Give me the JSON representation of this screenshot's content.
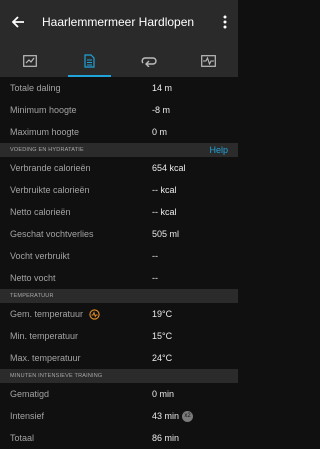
{
  "header": {
    "title": "Haarlemmermeer Hardlopen"
  },
  "tabs": [
    "chart-tab",
    "details-tab",
    "laps-tab",
    "graph-tab"
  ],
  "elevation": [
    {
      "label": "Totale daling",
      "value": "14 m"
    },
    {
      "label": "Minimum hoogte",
      "value": "-8 m"
    },
    {
      "label": "Maximum hoogte",
      "value": "0 m"
    }
  ],
  "nutrition": {
    "title": "VOEDING EN HYDRATATIE",
    "help": "Help",
    "rows": [
      {
        "label": "Verbrande calorieën",
        "value": "654 kcal"
      },
      {
        "label": "Verbruikte calorieën",
        "value": "-- kcal"
      },
      {
        "label": "Netto calorieën",
        "value": "-- kcal"
      },
      {
        "label": "Geschat vochtverlies",
        "value": "505 ml"
      },
      {
        "label": "Vocht verbruikt",
        "value": "--"
      },
      {
        "label": "Netto vocht",
        "value": "--"
      }
    ]
  },
  "temperature": {
    "title": "TEMPERATUUR",
    "rows": [
      {
        "label": "Gem. temperatuur",
        "value": "19°C"
      },
      {
        "label": "Min. temperatuur",
        "value": "15°C"
      },
      {
        "label": "Max. temperatuur",
        "value": "24°C"
      }
    ]
  },
  "intensity": {
    "title": "MINUTEN INTENSIEVE TRAINING",
    "rows": [
      {
        "label": "Gematigd",
        "value": "0 min"
      },
      {
        "label": "Intensief",
        "value": "43 min",
        "badge": "x2"
      },
      {
        "label": "Totaal",
        "value": "86 min"
      }
    ]
  },
  "colors": {
    "accent": "#1fa3d9",
    "warning": "#e8912b"
  }
}
